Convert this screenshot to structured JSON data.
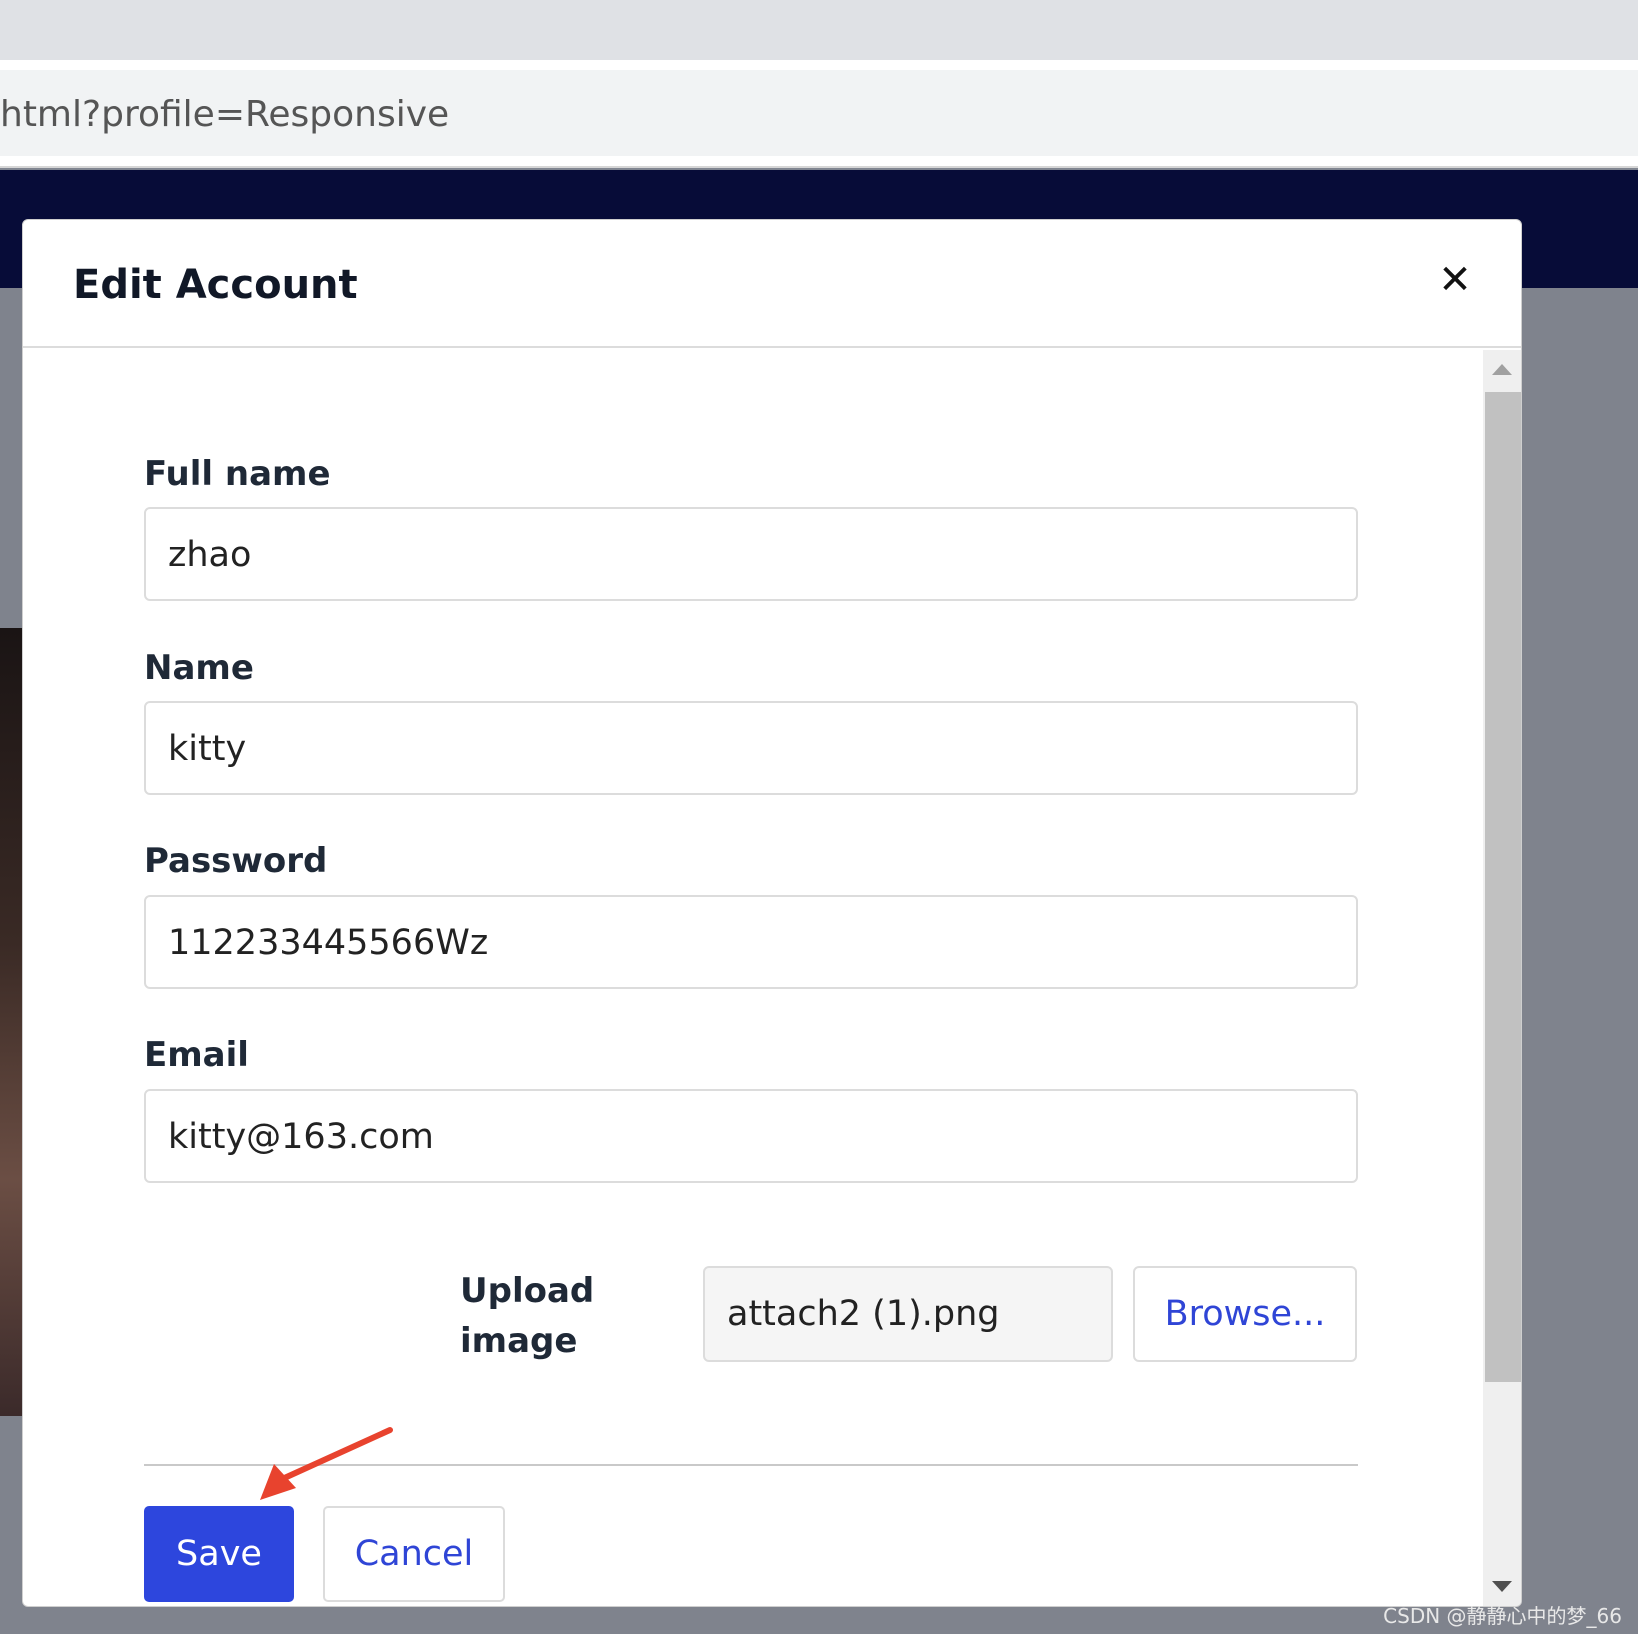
{
  "browser": {
    "url": "html?profile=Responsive"
  },
  "modal": {
    "title": "Edit Account",
    "close_icon": "close-icon",
    "fields": [
      {
        "label": "Full name",
        "value": "zhao"
      },
      {
        "label": "Name",
        "value": "kitty"
      },
      {
        "label": "Password",
        "value": "112233445566Wz"
      },
      {
        "label": "Email",
        "value": "kitty@163.com"
      }
    ],
    "upload": {
      "label": "Upload image",
      "file_name": "attach2 (1).png",
      "browse_label": "Browse..."
    },
    "actions": {
      "save_label": "Save",
      "cancel_label": "Cancel"
    }
  },
  "annotation": {
    "arrow_color": "#e8432e"
  },
  "watermark": "CSDN @静静心中的梦_66",
  "colors": {
    "primary": "#2d46dd",
    "nav_background": "#070c38",
    "link": "#2f45d6"
  }
}
